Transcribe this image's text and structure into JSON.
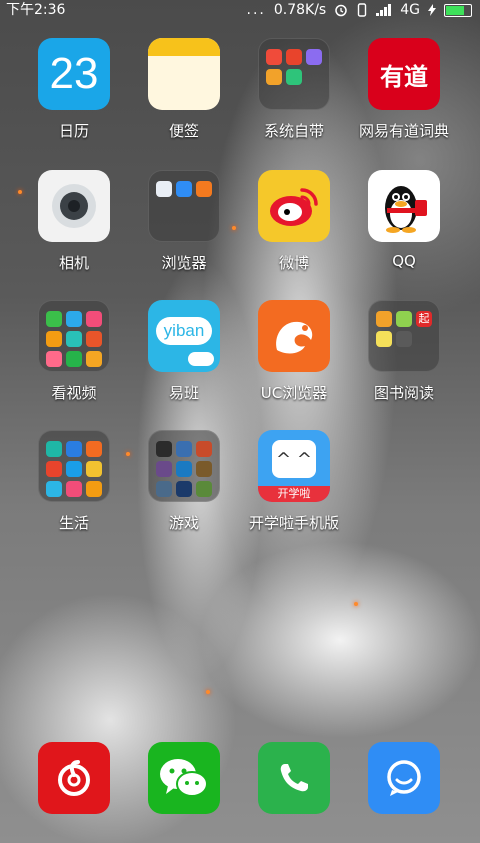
{
  "status_bar": {
    "time": "下午2:36",
    "dots": "...",
    "net_speed": "0.78K/s",
    "network": "4G"
  },
  "apps": {
    "calendar": {
      "label": "日历",
      "date": "23"
    },
    "notes": {
      "label": "便签"
    },
    "system_folder": {
      "label": "系统自带"
    },
    "youdao": {
      "label": "网易有道词典",
      "glyph": "有道"
    },
    "camera": {
      "label": "相机"
    },
    "browser_folder": {
      "label": "浏览器"
    },
    "weibo": {
      "label": "微博"
    },
    "qq": {
      "label": "QQ"
    },
    "video_folder": {
      "label": "看视频"
    },
    "yiban": {
      "label": "易班",
      "glyph": "yiban"
    },
    "uc": {
      "label": "UC浏览器"
    },
    "books_folder": {
      "label": "图书阅读",
      "badge": "起"
    },
    "life_folder": {
      "label": "生活"
    },
    "games_folder": {
      "label": "游戏"
    },
    "kaixue": {
      "label": "开学啦手机版",
      "badge": "开学啦"
    }
  },
  "dock": [
    {
      "name": "netease-music",
      "color": "#e0161b"
    },
    {
      "name": "wechat",
      "color": "#19b51f"
    },
    {
      "name": "phone",
      "color": "#2bb24c"
    },
    {
      "name": "messages",
      "color": "#2f8df5"
    }
  ],
  "colors": {
    "calendar": "#1aa6e8",
    "notes": "#fff7df",
    "youdao": "#d9001b",
    "camera": "#f2f2f2",
    "weibo": "#f5c82a",
    "qq": "#ffffff",
    "yiban": "#2cb6e6",
    "uc": "#f36b21",
    "kaixue": "#3da3f2"
  }
}
